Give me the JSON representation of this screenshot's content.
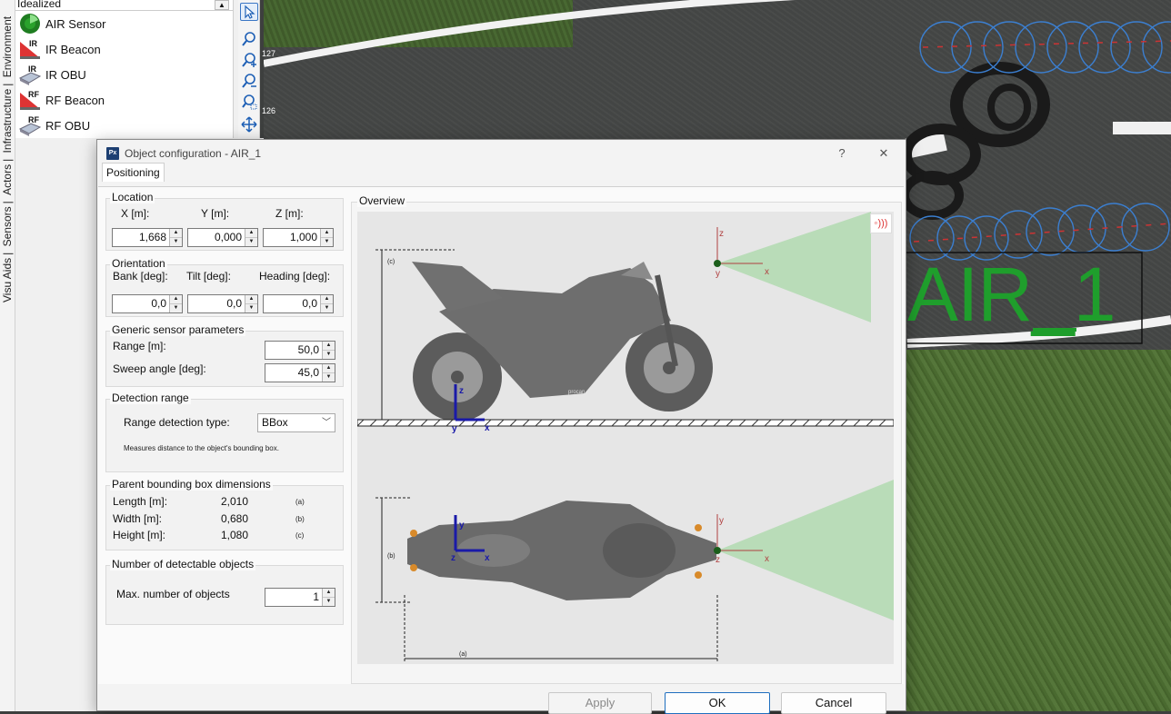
{
  "library": {
    "header": "Idealized",
    "items": [
      {
        "label": "AIR Sensor",
        "icon": "radar-sensor-icon"
      },
      {
        "label": "IR Beacon",
        "icon": "ir-beacon-icon"
      },
      {
        "label": "IR OBU",
        "icon": "ir-obu-icon"
      },
      {
        "label": "RF Beacon",
        "icon": "rf-beacon-icon"
      },
      {
        "label": "RF OBU",
        "icon": "rf-obu-icon"
      }
    ]
  },
  "side_tabs": [
    "Visu Aids",
    "Sensors",
    "Actors",
    "Infrastructure",
    "Environment"
  ],
  "ruler": [
    "127",
    "126"
  ],
  "scene_label": "AIR_1",
  "dialog": {
    "title": "Object configuration - AIR_1",
    "help": "?",
    "close": "✕",
    "tab": "Positioning",
    "location": {
      "title": "Location",
      "x_label": "X [m]:",
      "y_label": "Y [m]:",
      "z_label": "Z [m]:",
      "x": "1,668",
      "y": "0,000",
      "z": "1,000"
    },
    "orientation": {
      "title": "Orientation",
      "bank_label": "Bank [deg]:",
      "tilt_label": "Tilt [deg]:",
      "heading_label": "Heading [deg]:",
      "bank": "0,0",
      "tilt": "0,0",
      "heading": "0,0"
    },
    "generic": {
      "title": "Generic sensor parameters",
      "range_label": "Range  [m]:",
      "range": "50,0",
      "sweep_label": "Sweep angle [deg]:",
      "sweep": "45,0"
    },
    "detection": {
      "title": "Detection range",
      "type_label": "Range detection type:",
      "type_value": "BBox",
      "note": "Measures distance to the object's bounding box."
    },
    "bbox": {
      "title": "Parent bounding box dimensions",
      "rows": [
        {
          "label": "Length [m]:",
          "value": "2,010",
          "tag": "(a)"
        },
        {
          "label": "Width [m]:",
          "value": "0,680",
          "tag": "(b)"
        },
        {
          "label": "Height [m]:",
          "value": "1,080",
          "tag": "(c)"
        }
      ]
    },
    "detectable": {
      "title": "Number of detectable objects",
      "max_label": "Max. number of objects",
      "max": "1"
    },
    "overview": {
      "title": "Overview",
      "tags": {
        "a": "(a)",
        "b": "(b)",
        "c": "(c)"
      },
      "axes": {
        "x": "x",
        "y": "y",
        "z": "z"
      },
      "bike_text": "procan"
    },
    "buttons": {
      "apply": "Apply",
      "ok": "OK",
      "cancel": "Cancel"
    }
  }
}
